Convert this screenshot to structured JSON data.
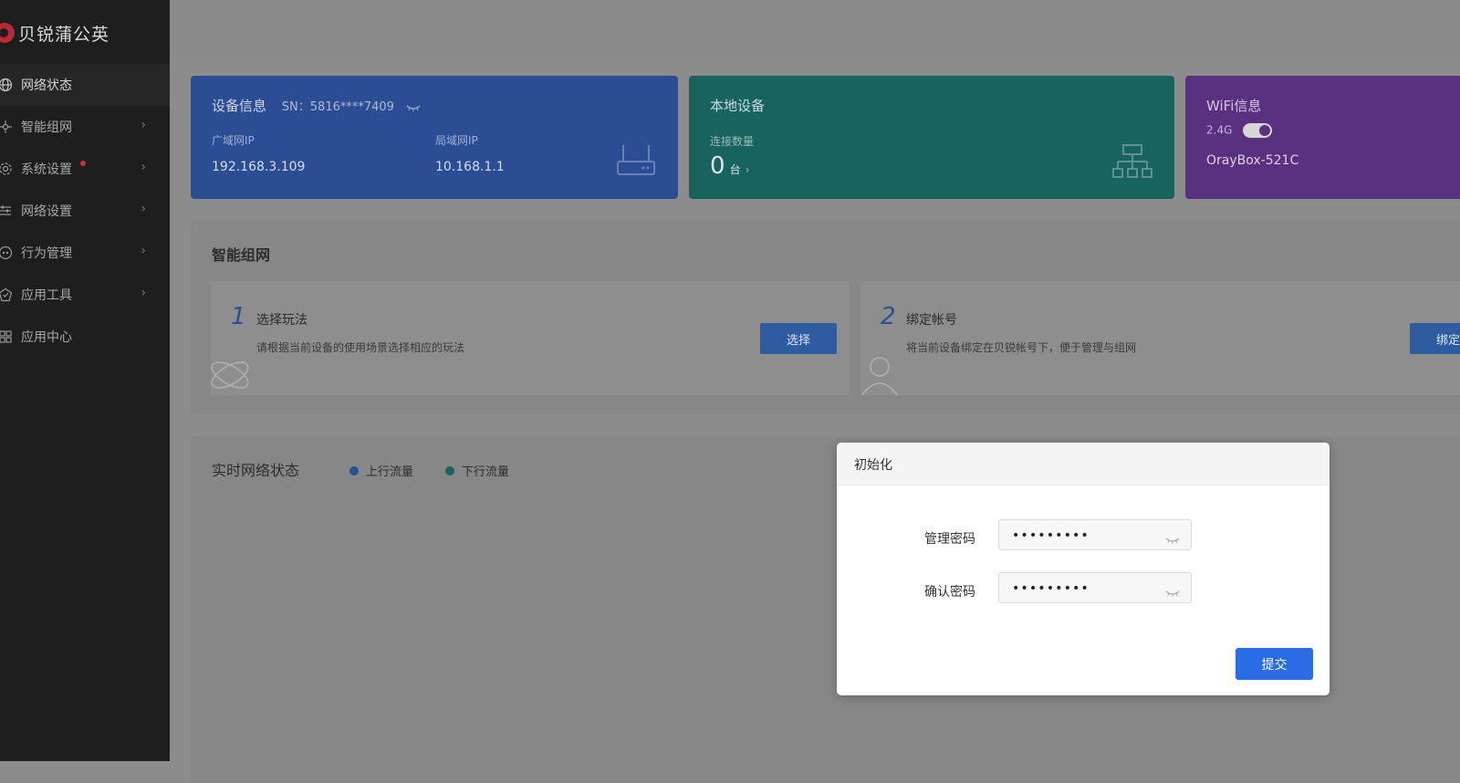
{
  "brand": {
    "name": "贝锐蒲公英"
  },
  "sidebar": {
    "items": [
      {
        "label": "网络状态",
        "icon": "globe-icon"
      },
      {
        "label": "智能组网",
        "icon": "network-icon"
      },
      {
        "label": "系统设置",
        "icon": "gear-icon"
      },
      {
        "label": "网络设置",
        "icon": "sliders-icon"
      },
      {
        "label": "行为管理",
        "icon": "behavior-icon"
      },
      {
        "label": "应用工具",
        "icon": "tool-icon"
      },
      {
        "label": "应用中心",
        "icon": "apps-icon"
      }
    ]
  },
  "device_card": {
    "title": "设备信息",
    "sn": "SN：5816****7409",
    "wan_label": "广域网IP",
    "wan_ip": "192.168.3.109",
    "lan_label": "局域网IP",
    "lan_ip": "10.168.1.1"
  },
  "local_card": {
    "title": "本地设备",
    "count_label": "连接数量",
    "count": "0",
    "unit": "台",
    "arrow": "›"
  },
  "wifi_card": {
    "title": "WiFi信息",
    "band": "2.4G",
    "ssid": "OrayBox-521C"
  },
  "smart_network": {
    "title": "智能组网",
    "steps": [
      {
        "num": "1",
        "title": "选择玩法",
        "desc": "请根据当前设备的使用场景选择相应的玩法",
        "button": "选择"
      },
      {
        "num": "2",
        "title": "绑定帐号",
        "desc": "将当前设备绑定在贝锐帐号下，便于管理与组网",
        "button": "绑定"
      }
    ]
  },
  "realtime": {
    "title": "实时网络状态",
    "legend": [
      {
        "label": "上行流量",
        "color": "#2a4d94"
      },
      {
        "label": "下行流量",
        "color": "#19635f"
      }
    ]
  },
  "modal": {
    "title": "初始化",
    "fields": [
      {
        "label": "管理密码",
        "value": "•••••••••"
      },
      {
        "label": "确认密码",
        "value": "•••••••••"
      }
    ],
    "submit": "提交"
  },
  "colors": {
    "accent": "#2a6be6",
    "sidebar_bg": "#1e1e1e",
    "alert_dot": "#d0303a"
  }
}
